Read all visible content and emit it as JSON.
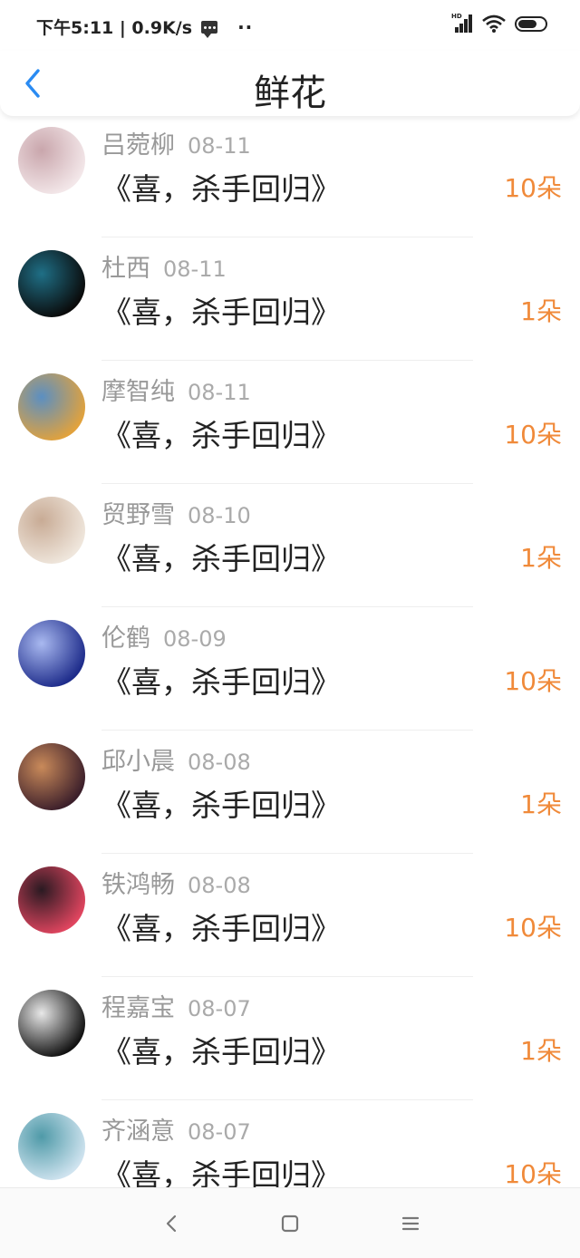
{
  "status_bar": {
    "time_speed": "下午5:11 | 0.9K/s",
    "dots": "··",
    "network_badge": "HD"
  },
  "header": {
    "title": "鲜花",
    "back_icon": "chevron-left-icon"
  },
  "items": [
    {
      "name": "吕菀柳",
      "date": "08-11",
      "book": "《喜，杀手回归》",
      "count": "10朵",
      "avatar_colors": [
        "#f3e7e9",
        "#c9a6ac"
      ]
    },
    {
      "name": "杜西",
      "date": "08-11",
      "book": "《喜，杀手回归》",
      "count": "1朵",
      "avatar_colors": [
        "#0a0a0a",
        "#1f6f86"
      ]
    },
    {
      "name": "摩智纯",
      "date": "08-11",
      "book": "《喜，杀手回归》",
      "count": "10朵",
      "avatar_colors": [
        "#e2a23c",
        "#5b8fc2"
      ]
    },
    {
      "name": "贸野雪",
      "date": "08-10",
      "book": "《喜，杀手回归》",
      "count": "1朵",
      "avatar_colors": [
        "#efe6dc",
        "#c8ab95"
      ]
    },
    {
      "name": "伦鹤",
      "date": "08-09",
      "book": "《喜，杀手回归》",
      "count": "10朵",
      "avatar_colors": [
        "#1d2b8a",
        "#a9b9f0"
      ]
    },
    {
      "name": "邱小晨",
      "date": "08-08",
      "book": "《喜，杀手回归》",
      "count": "1朵",
      "avatar_colors": [
        "#3b1e2a",
        "#c98a5a"
      ]
    },
    {
      "name": "铁鸿畅",
      "date": "08-08",
      "book": "《喜，杀手回归》",
      "count": "10朵",
      "avatar_colors": [
        "#e0455f",
        "#2a1a22"
      ]
    },
    {
      "name": "程嘉宝",
      "date": "08-07",
      "book": "《喜，杀手回归》",
      "count": "1朵",
      "avatar_colors": [
        "#111111",
        "#e8e8e8"
      ]
    },
    {
      "name": "齐涵意",
      "date": "08-07",
      "book": "《喜，杀手回归》",
      "count": "10朵",
      "avatar_colors": [
        "#cfe3ef",
        "#4f9aa8"
      ]
    }
  ],
  "navbar": {
    "back_icon": "nav-back-icon",
    "home_icon": "nav-home-icon",
    "menu_icon": "nav-menu-icon"
  },
  "colors": {
    "accent_blue": "#2a8bf2",
    "count_orange": "#f08a3a",
    "text_gray": "#999999"
  }
}
